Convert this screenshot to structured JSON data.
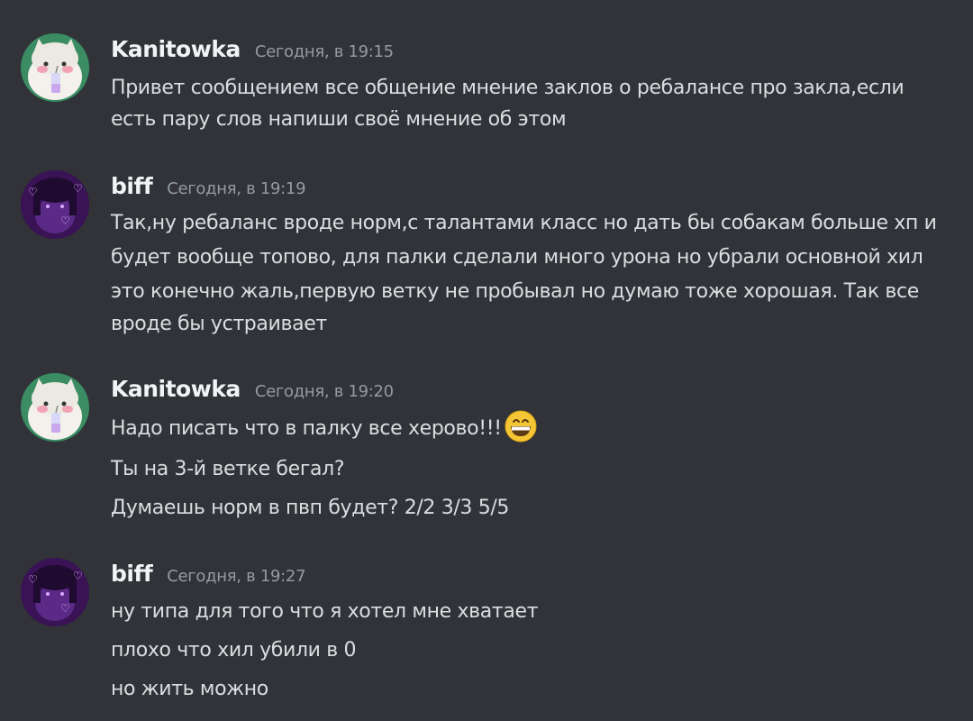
{
  "messages": [
    {
      "author": "Kanitowka",
      "time": "Сегодня, в 19:15",
      "lines": [
        "Привет сообщением все общение мнение заклов о ребалансе про закла,если",
        "есть пару слов напиши своё мнение об этом"
      ]
    },
    {
      "author": "biff",
      "time": "Сегодня, в 19:19",
      "lines": [
        "Так,ну ребаланс вроде норм,с талантами класс но дать бы собакам больше хп и",
        "будет вообще топово, для палки сделали много урона но убрали основной хил",
        "это конечно жаль,первую ветку не пробывал но думаю тоже хорошая. Так все",
        "вроде бы устраивает"
      ]
    },
    {
      "author": "Kanitowka",
      "time": "Сегодня, в 19:20",
      "lines": [
        "Надо писать что в палку все херово!!!",
        "Ты на 3-й ветке бегал?",
        "Думаешь норм в пвп будет? 2/2 3/3 5/5"
      ]
    },
    {
      "author": "biff",
      "time": "Сегодня, в 19:27",
      "lines": [
        "ну типа для того что я хотел мне хватает",
        "плохо что хил убили в 0",
        "но жить можно"
      ]
    }
  ],
  "colors": {
    "background": "#313338",
    "username": "#f2f3f5",
    "timestamp": "#949ba4",
    "text": "#dbdee1"
  },
  "icons": {
    "grin": "grinning-face-emoji"
  }
}
